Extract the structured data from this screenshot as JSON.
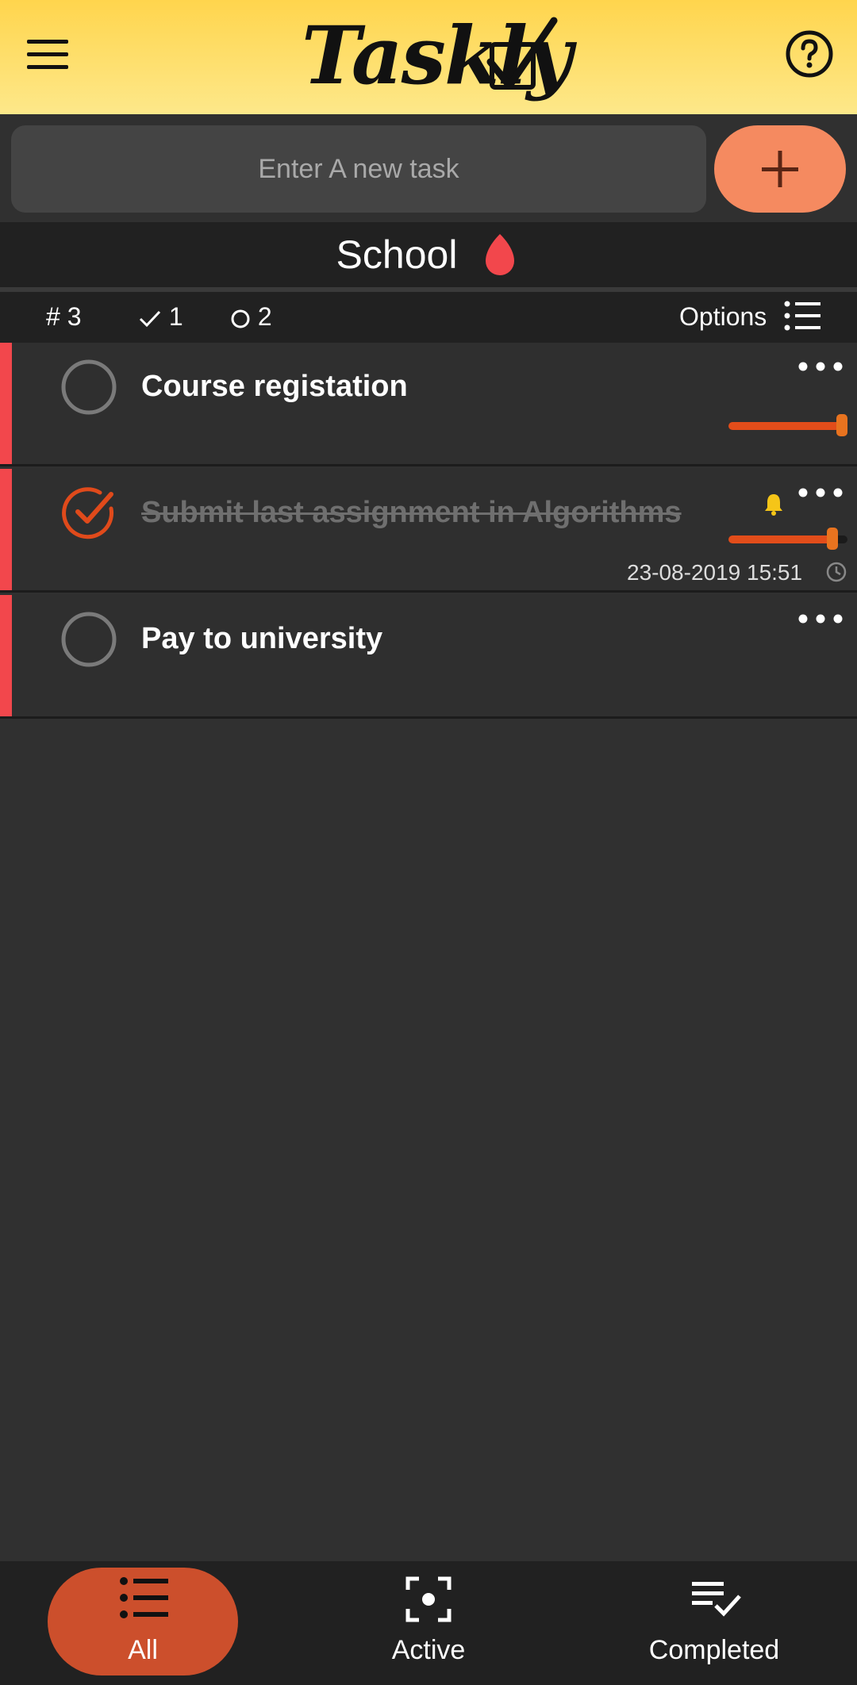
{
  "header": {
    "app_name": "Taskly",
    "brand_color": "#ffd54d",
    "menu_icon": "hamburger-menu-icon",
    "help_icon": "help-circle-icon"
  },
  "new_task": {
    "placeholder": "Enter A new task",
    "add_icon": "plus-icon",
    "add_color": "#f58a60"
  },
  "list": {
    "title": "School",
    "color": "#f2474c"
  },
  "stats": {
    "total": "3",
    "completed": "1",
    "open": "2",
    "options_label": "Options"
  },
  "tasks": [
    {
      "title": "Course registation",
      "done": false,
      "priority": 1.0
    },
    {
      "title": "Submit last assignment in Algorithms",
      "done": true,
      "priority": 0.9,
      "reminder": true,
      "due": "23-08-2019 15:51"
    },
    {
      "title": "Pay to university",
      "done": false
    }
  ],
  "nav": {
    "all": "All",
    "active": "Active",
    "completed": "Completed",
    "selected": "All",
    "selected_color": "#cc4f2c"
  }
}
